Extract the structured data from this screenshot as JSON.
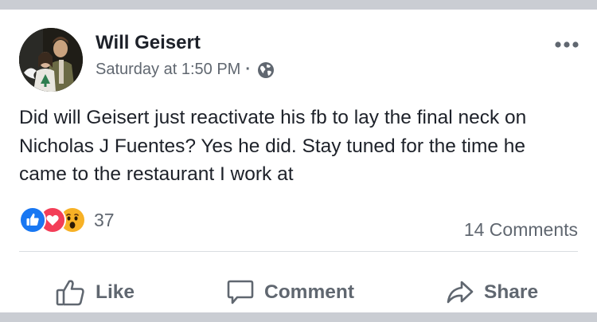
{
  "post": {
    "author": "Will Geisert",
    "timestamp": "Saturday at 1:50 PM",
    "separator": "·",
    "privacy_icon": "globe-icon",
    "menu_icon": "more-options-icon",
    "text": "Did will Geisert just reactivate his fb to lay the final neck on Nicholas J Fuentes? Yes he did. Stay tuned for the time he came to the restaurant I work at"
  },
  "reactions": {
    "types": [
      "like",
      "love",
      "wow"
    ],
    "count": "37"
  },
  "comments": {
    "label": "14 Comments"
  },
  "actions": {
    "like": "Like",
    "comment": "Comment",
    "share": "Share"
  },
  "colors": {
    "text": "#1d2129",
    "secondary": "#606770",
    "like_blue": "#1877f2",
    "love_red": "#f33e58",
    "wow_yellow": "#f7b125",
    "divider": "#dadde1"
  }
}
